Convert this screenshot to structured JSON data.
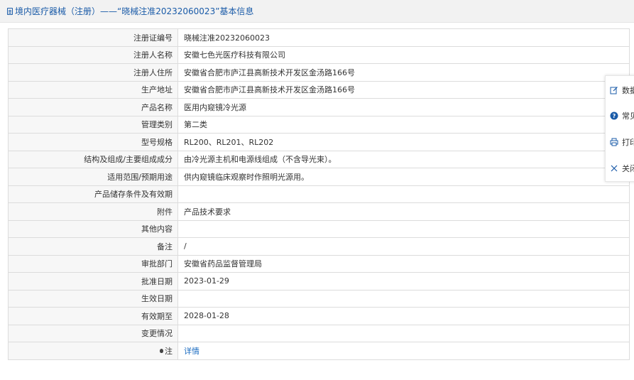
{
  "header": {
    "title": "境内医疗器械（注册）——“晓械注准20232060023”基本信息"
  },
  "rows": [
    {
      "label": "注册证编号",
      "value": "晓械注准20232060023"
    },
    {
      "label": "注册人名称",
      "value": "安徽七色光医疗科技有限公司"
    },
    {
      "label": "注册人住所",
      "value": "安徽省合肥市庐江县高新技术开发区金汤路166号"
    },
    {
      "label": "生产地址",
      "value": "安徽省合肥市庐江县高新技术开发区金汤路166号"
    },
    {
      "label": "产品名称",
      "value": "医用内窥镜冷光源"
    },
    {
      "label": "管理类别",
      "value": "第二类"
    },
    {
      "label": "型号规格",
      "value": "RL200、RL201、RL202"
    },
    {
      "label": "结构及组成/主要组成成分",
      "value": "由冷光源主机和电源线组成（不含导光束）。"
    },
    {
      "label": "适用范围/预期用途",
      "value": "供内窥镜临床观察时作照明光源用。"
    },
    {
      "label": "产品储存条件及有效期",
      "value": ""
    },
    {
      "label": "附件",
      "value": "产品技术要求"
    },
    {
      "label": "其他内容",
      "value": ""
    },
    {
      "label": "备注",
      "value": "/"
    },
    {
      "label": "审批部门",
      "value": "安徽省药品监督管理局"
    },
    {
      "label": "批准日期",
      "value": "2023-01-29"
    },
    {
      "label": "生效日期",
      "value": ""
    },
    {
      "label": "有效期至",
      "value": "2028-01-28"
    },
    {
      "label": "变更情况",
      "value": ""
    }
  ],
  "note_row": {
    "label": "注",
    "icon": "bulb-icon",
    "link_text": "详情"
  },
  "side_panel": {
    "items": [
      {
        "label": "数据",
        "icon": "edit-icon"
      },
      {
        "label": "常见",
        "icon": "question-icon"
      },
      {
        "label": "打印",
        "icon": "print-icon"
      },
      {
        "label": "关闭",
        "icon": "close-icon"
      }
    ]
  },
  "colors": {
    "header_text": "#1a5ba8",
    "link": "#1a6bc0",
    "label_bg": "#f7f7f7",
    "border": "#dcdcdc"
  }
}
